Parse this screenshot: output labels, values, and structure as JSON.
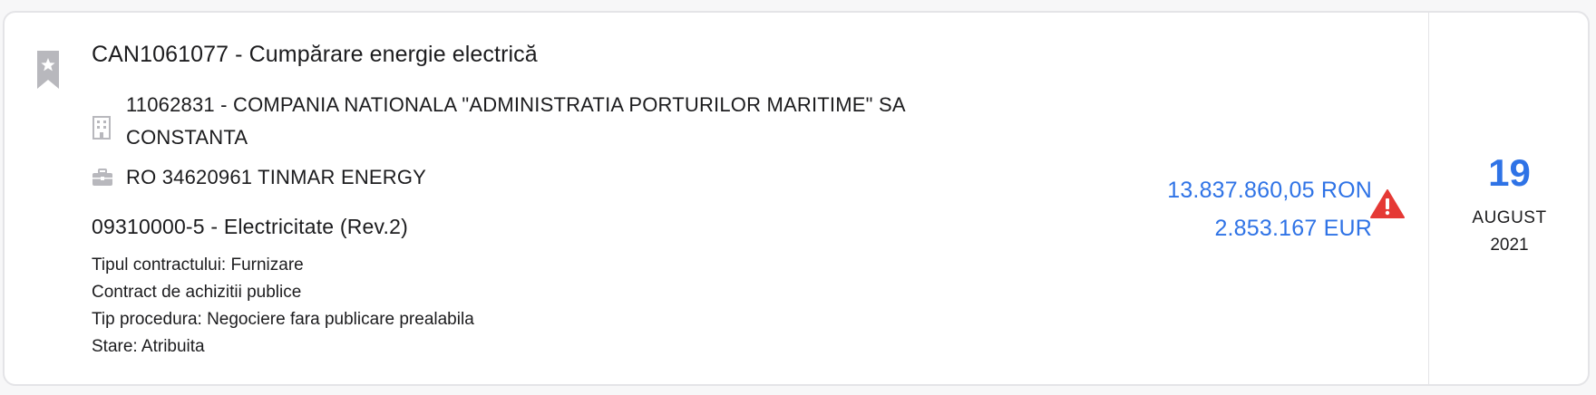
{
  "notice": {
    "title": "CAN1061077 - Cumpărare energie electrică",
    "buyer": "11062831 - COMPANIA NATIONALA \"ADMINISTRATIA PORTURILOR MARITIME\" SA CONSTANTA",
    "supplier": "RO 34620961 TINMAR ENERGY",
    "cpv": "09310000-5 - Electricitate (Rev.2)",
    "details": [
      "Tipul contractului: Furnizare",
      "Contract de achizitii publice",
      "Tip procedura: Negociere fara publicare prealabila",
      "Stare: Atribuita"
    ],
    "value_ron": "13.837.860,05 RON",
    "value_eur": "2.853.167 EUR",
    "date": {
      "day": "19",
      "month": "AUGUST",
      "year": "2021"
    }
  },
  "icons": {
    "bookmark": "bookmark-star-icon",
    "buyer": "building-icon",
    "supplier": "briefcase-icon",
    "warning": "warning-triangle-icon"
  },
  "colors": {
    "accent": "#2f73e6",
    "warning": "#e53935",
    "icon_gray": "#b8b8bd",
    "border": "#e4e4e7"
  }
}
